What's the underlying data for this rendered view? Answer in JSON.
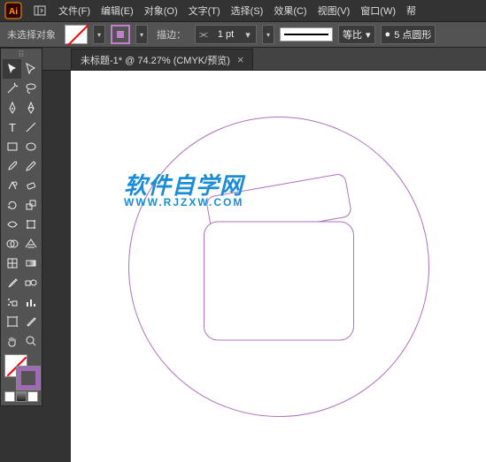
{
  "app": {
    "name": "Ai"
  },
  "menu": {
    "items": [
      "文件(F)",
      "编辑(E)",
      "对象(O)",
      "文字(T)",
      "选择(S)",
      "效果(C)",
      "视图(V)",
      "窗口(W)",
      "帮"
    ]
  },
  "options": {
    "selection_status": "未选择对象",
    "stroke_label": "描边：",
    "stroke_width": "1 pt",
    "scale_mode": "等比",
    "brush_preset": "5 点圆形"
  },
  "document": {
    "tab_title": "未标题-1* @ 74.27% (CMYK/预览)"
  },
  "watermark": {
    "title": "软件自学网",
    "url": "WWW.RJZXW.COM"
  },
  "tools": [
    [
      "selection",
      "direct-selection"
    ],
    [
      "magic-wand",
      "lasso"
    ],
    [
      "pen",
      "curvature-pen"
    ],
    [
      "type",
      "line-segment"
    ],
    [
      "rectangle",
      "ellipse"
    ],
    [
      "paintbrush",
      "pencil"
    ],
    [
      "shaper",
      "eraser"
    ],
    [
      "rotate",
      "scale"
    ],
    [
      "width",
      "free-transform"
    ],
    [
      "shape-builder",
      "perspective-grid"
    ],
    [
      "mesh",
      "gradient"
    ],
    [
      "eyedropper",
      "blend"
    ],
    [
      "symbol-sprayer",
      "column-graph"
    ],
    [
      "artboard",
      "slice"
    ],
    [
      "hand",
      "zoom"
    ]
  ],
  "colors": {
    "accent": "#b070c0",
    "brand": "#ff9a00"
  }
}
